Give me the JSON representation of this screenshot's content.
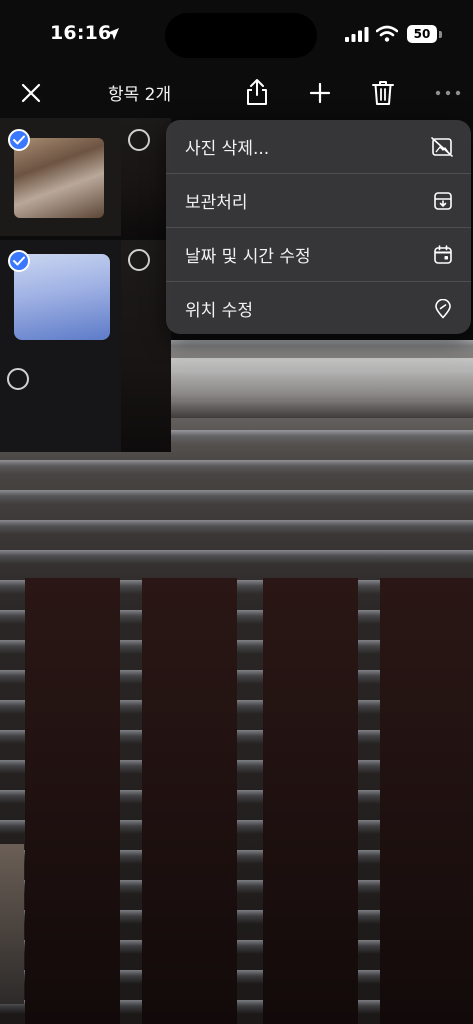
{
  "status_bar": {
    "time": "16:16",
    "battery": "50"
  },
  "toolbar": {
    "title": "항목 2개"
  },
  "menu": {
    "items": [
      {
        "label": "사진 삭제...",
        "icon": "photo-slash-icon"
      },
      {
        "label": "보관처리",
        "icon": "archive-icon"
      },
      {
        "label": "날짜 및 시간 수정",
        "icon": "calendar-icon"
      },
      {
        "label": "위치 수정",
        "icon": "location-pin-icon"
      }
    ]
  },
  "selection": {
    "selected_count": 2
  },
  "colors": {
    "accent": "#3a78ff",
    "menu_bg": "#3a3a3c"
  }
}
